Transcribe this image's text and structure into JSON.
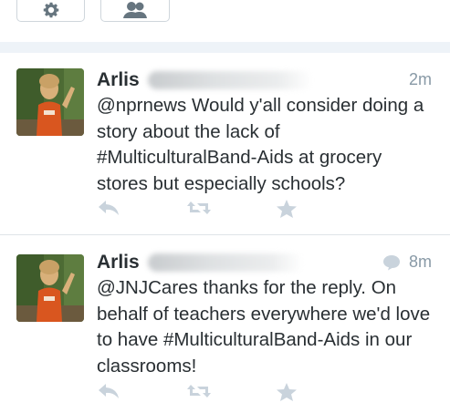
{
  "toolbar": {
    "buttons": [
      {
        "icon": "gear-icon"
      },
      {
        "icon": "people-icon"
      }
    ]
  },
  "colors": {
    "text": "#292f33",
    "muted": "#8899a6",
    "action_icons": "#c9d3dc",
    "separator": "#eef3f8"
  },
  "tweets": [
    {
      "name": "Arlis",
      "time": "2m",
      "text": "@nprnews Would y'all consider doing a story about the lack of #MulticulturalBand-Aids at grocery stores but especially schools?",
      "actions": [
        "reply-icon",
        "retweet-icon",
        "favorite-icon"
      ]
    },
    {
      "name": "Arlis",
      "time": "8m",
      "conversation_icon": "speech-bubble-icon",
      "text": "@JNJCares thanks for the reply. On behalf of teachers everywhere we'd love to have #MulticulturalBand-Aids in our classrooms!",
      "actions": [
        "reply-icon",
        "retweet-icon",
        "favorite-icon"
      ]
    }
  ]
}
